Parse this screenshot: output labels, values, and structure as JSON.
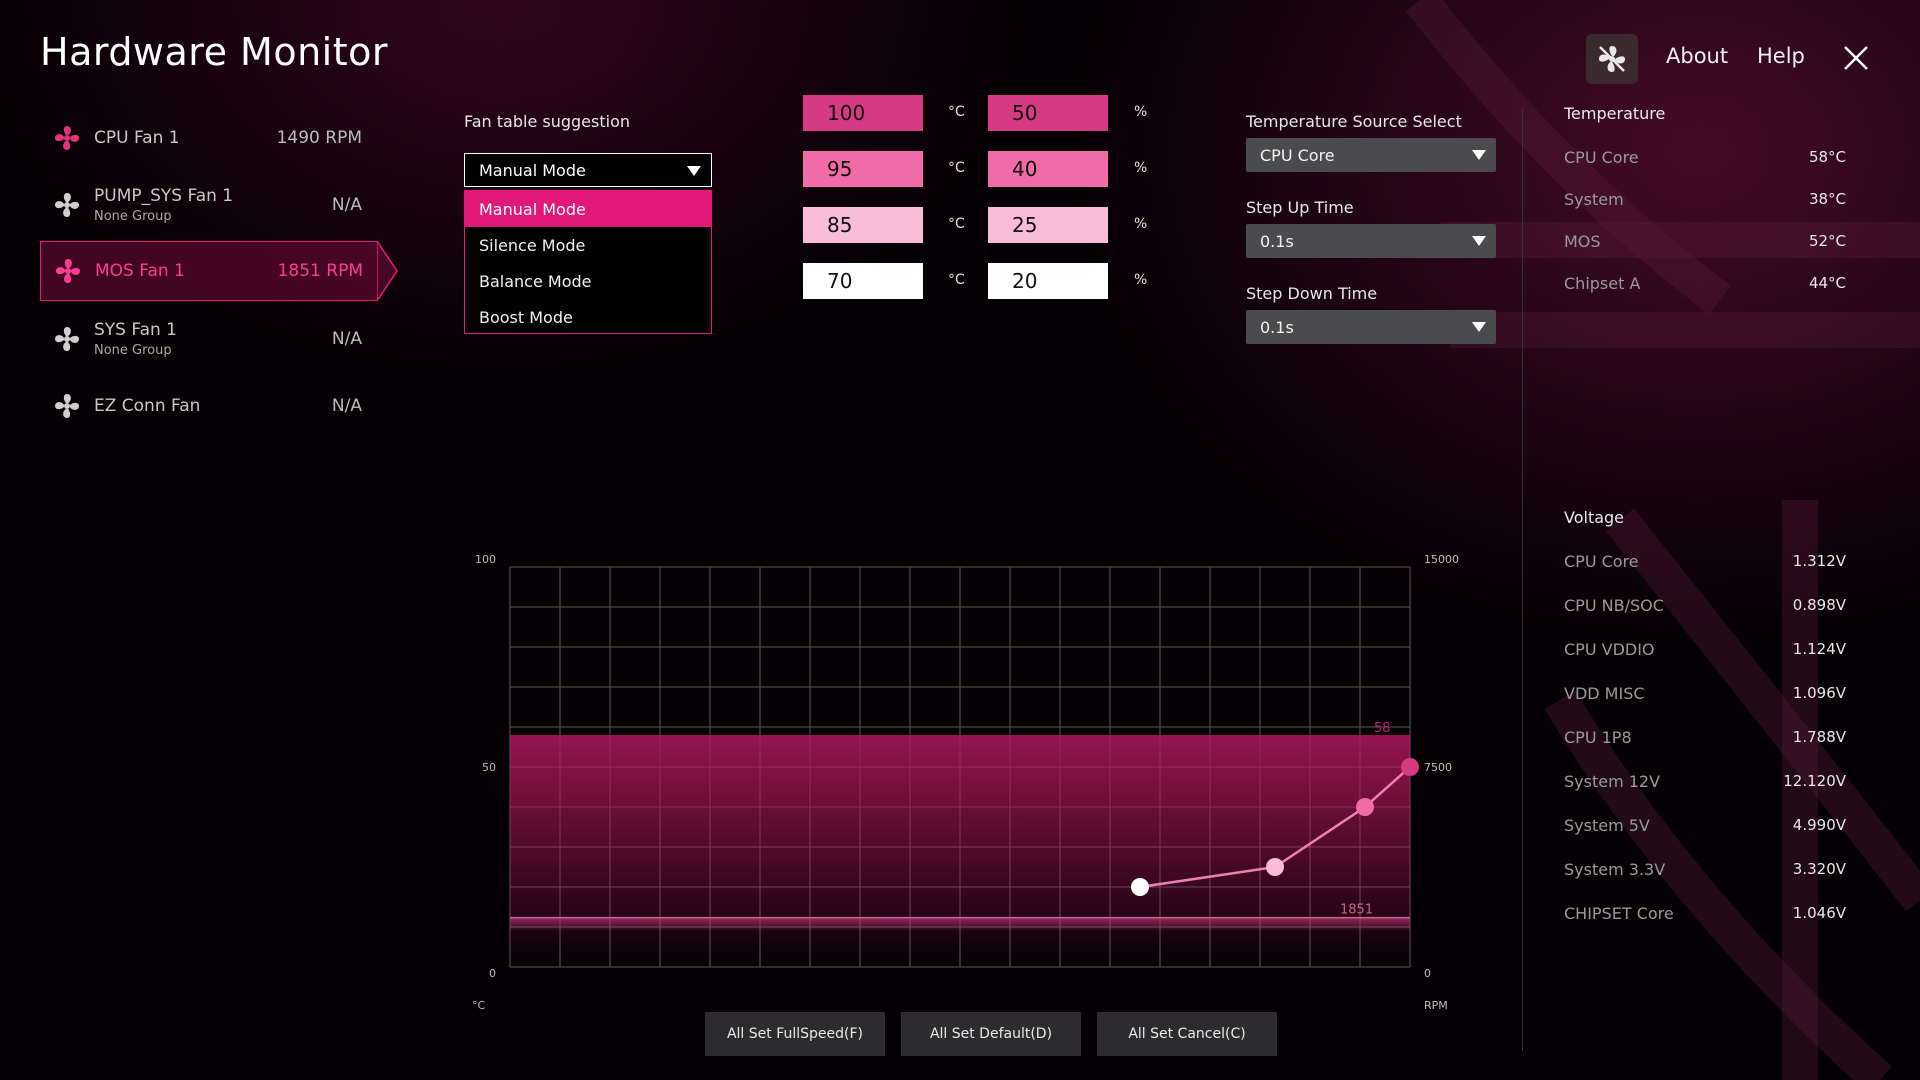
{
  "app": {
    "title": "Hardware Monitor"
  },
  "header": {
    "about": "About",
    "help": "Help"
  },
  "fans": [
    {
      "name": "CPU Fan 1",
      "group": "",
      "value": "1490 RPM",
      "active": false
    },
    {
      "name": "PUMP_SYS Fan 1",
      "group": "None Group",
      "value": "N/A",
      "active": false
    },
    {
      "name": "MOS Fan 1",
      "group": "",
      "value": "1851 RPM",
      "active": true
    },
    {
      "name": "SYS Fan 1",
      "group": "None Group",
      "value": "N/A",
      "active": false
    },
    {
      "name": "EZ Conn Fan",
      "group": "",
      "value": "N/A",
      "active": false
    }
  ],
  "fan_table": {
    "label": "Fan table suggestion",
    "selected": "Manual Mode",
    "options": [
      "Manual Mode",
      "Silence Mode",
      "Balance Mode",
      "Boost Mode"
    ]
  },
  "points": [
    {
      "temp": "100",
      "percent": "50",
      "temp_unit": "°C",
      "percent_unit": "%",
      "color": "#d63a82"
    },
    {
      "temp": "95",
      "percent": "40",
      "temp_unit": "°C",
      "percent_unit": "%",
      "color": "#f06ba8"
    },
    {
      "temp": "85",
      "percent": "25",
      "temp_unit": "°C",
      "percent_unit": "%",
      "color": "#f8bcd7"
    },
    {
      "temp": "70",
      "percent": "20",
      "temp_unit": "°C",
      "percent_unit": "%",
      "color": "#ffffff"
    }
  ],
  "config": {
    "temp_source_label": "Temperature Source Select",
    "temp_source_value": "CPU Core",
    "step_up_label": "Step Up Time",
    "step_up_value": "0.1s",
    "step_down_label": "Step Down Time",
    "step_down_value": "0.1s"
  },
  "temperature": {
    "title": "Temperature",
    "items": [
      {
        "label": "CPU Core",
        "value": "58°C"
      },
      {
        "label": "System",
        "value": "38°C"
      },
      {
        "label": "MOS",
        "value": "52°C"
      },
      {
        "label": "Chipset A",
        "value": "44°C"
      }
    ]
  },
  "voltage": {
    "title": "Voltage",
    "items": [
      {
        "label": "CPU Core",
        "value": "1.312V"
      },
      {
        "label": "CPU NB/SOC",
        "value": "0.898V"
      },
      {
        "label": "CPU VDDIO",
        "value": "1.124V"
      },
      {
        "label": "VDD MISC",
        "value": "1.096V"
      },
      {
        "label": "CPU 1P8",
        "value": "1.788V"
      },
      {
        "label": "System 12V",
        "value": "12.120V"
      },
      {
        "label": "System 5V",
        "value": "4.990V"
      },
      {
        "label": "System 3.3V",
        "value": "3.320V"
      },
      {
        "label": "CHIPSET Core",
        "value": "1.046V"
      }
    ]
  },
  "chart_data": {
    "type": "line",
    "x_range": [
      0,
      100
    ],
    "left_axis": {
      "ticks": [
        "100",
        "50",
        "0"
      ],
      "unit": "°C",
      "range": [
        0,
        100
      ]
    },
    "right_axis": {
      "ticks": [
        "15000",
        "7500",
        "0"
      ],
      "unit": "RPM",
      "range": [
        0,
        15000
      ]
    },
    "temp_level": 58,
    "temp_label": "58",
    "rpm_level": 1851,
    "rpm_label": "1851",
    "curve": [
      {
        "temp": 70,
        "percent": 20,
        "color": "#ffffff"
      },
      {
        "temp": 85,
        "percent": 25,
        "color": "#f8bcd7"
      },
      {
        "temp": 95,
        "percent": 40,
        "color": "#f06ba8"
      },
      {
        "temp": 100,
        "percent": 50,
        "color": "#d63a82"
      }
    ],
    "colors": {
      "line": "#f07fb4",
      "band": "#b0185e",
      "grid": "#5a5a5a"
    }
  },
  "buttons": {
    "full_speed": "All Set FullSpeed(F)",
    "default": "All Set Default(D)",
    "cancel": "All Set Cancel(C)"
  }
}
